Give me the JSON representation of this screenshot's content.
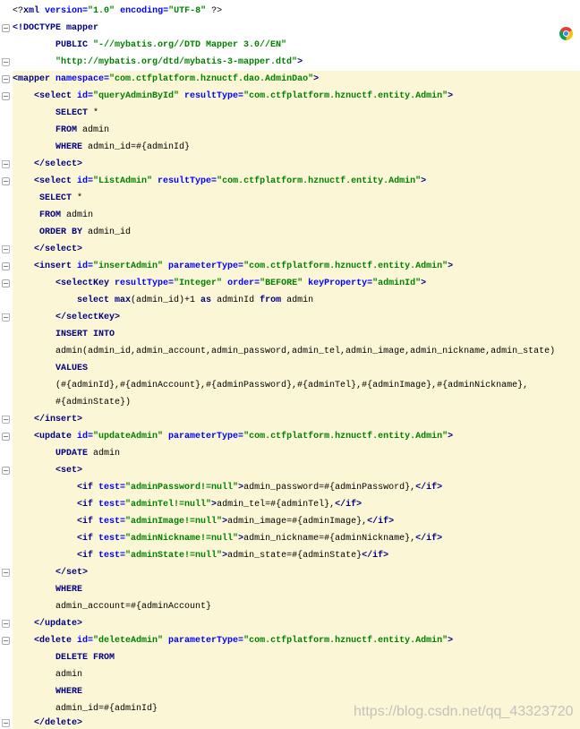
{
  "colors": {
    "tag": "#000080",
    "attr": "#0000ff",
    "val": "#008000",
    "kw": "#000080",
    "txt": "#000000",
    "highlight": "#fbf6d5",
    "gutter": "#ffffff"
  },
  "browser_popup": {
    "icon": "chrome-icon"
  },
  "watermark": {
    "text": "https://blog.csdn.net/qq_43323720"
  },
  "editor": {
    "lines": [
      {
        "tokens": [
          {
            "txt": "<?"
          },
          {
            "tag": "xml"
          },
          {
            "attr": " version="
          },
          {
            "val": "\"1.0\""
          },
          {
            "attr": " encoding="
          },
          {
            "val": "\"UTF-8\""
          },
          {
            "txt": " ?>"
          }
        ]
      },
      {
        "fold_icon": "fold-collapse-icon",
        "tokens": [
          {
            "tag": "<!DOCTYPE mapper"
          }
        ]
      },
      {
        "tokens": [
          {
            "tag": "        PUBLIC "
          },
          {
            "val": "\"-//mybatis.org//DTD Mapper 3.0//EN\""
          }
        ]
      },
      {
        "fold_icon": "fold-end-icon",
        "tokens": [
          {
            "val": "        \"http://mybatis.org/dtd/mybatis-3-mapper.dtd\""
          },
          {
            "tag": ">"
          }
        ]
      },
      {
        "highlighted": true,
        "fold_icon": "fold-collapse-icon",
        "tokens": [
          {
            "tag": "<mapper"
          },
          {
            "attr": " namespace="
          },
          {
            "val": "\"com.ctfplatform.hznuctf.dao.AdminDao\""
          },
          {
            "tag": ">"
          }
        ]
      },
      {
        "highlighted": true,
        "fold_icon": "fold-collapse-icon",
        "tokens": [
          {
            "tag": "    <select"
          },
          {
            "attr": " id="
          },
          {
            "val": "\"queryAdminById\""
          },
          {
            "attr": " resultType="
          },
          {
            "val": "\"com.ctfplatform.hznuctf.entity.Admin\""
          },
          {
            "tag": ">"
          }
        ]
      },
      {
        "highlighted": true,
        "tokens": [
          {
            "kw": "        SELECT"
          },
          {
            "txt": " *"
          }
        ]
      },
      {
        "highlighted": true,
        "tokens": [
          {
            "kw": "        FROM"
          },
          {
            "txt": " admin"
          }
        ]
      },
      {
        "highlighted": true,
        "tokens": [
          {
            "kw": "        WHERE"
          },
          {
            "txt": " admin_id=#{adminId}"
          }
        ]
      },
      {
        "highlighted": true,
        "fold_icon": "fold-end-icon",
        "tokens": [
          {
            "tag": "    </select>"
          }
        ]
      },
      {
        "highlighted": true,
        "fold_icon": "fold-collapse-icon",
        "tokens": [
          {
            "tag": "    <select"
          },
          {
            "attr": " id="
          },
          {
            "val": "\"ListAdmin\""
          },
          {
            "attr": " resultType="
          },
          {
            "val": "\"com.ctfplatform.hznuctf.entity.Admin\""
          },
          {
            "tag": ">"
          }
        ]
      },
      {
        "highlighted": true,
        "tokens": [
          {
            "kw": "     SELECT"
          },
          {
            "txt": " *"
          }
        ]
      },
      {
        "highlighted": true,
        "tokens": [
          {
            "kw": "     FROM"
          },
          {
            "txt": " admin"
          }
        ]
      },
      {
        "highlighted": true,
        "tokens": [
          {
            "kw": "     ORDER BY"
          },
          {
            "txt": " admin_id"
          }
        ]
      },
      {
        "highlighted": true,
        "fold_icon": "fold-end-icon",
        "tokens": [
          {
            "tag": "    </select>"
          }
        ]
      },
      {
        "highlighted": true,
        "fold_icon": "fold-collapse-icon",
        "tokens": [
          {
            "tag": "    <insert"
          },
          {
            "attr": " id="
          },
          {
            "val": "\"insertAdmin\""
          },
          {
            "attr": " parameterType="
          },
          {
            "val": "\"com.ctfplatform.hznuctf.entity.Admin\""
          },
          {
            "tag": ">"
          }
        ]
      },
      {
        "highlighted": true,
        "fold_icon": "fold-collapse-icon",
        "tokens": [
          {
            "tag": "        <selectKey"
          },
          {
            "attr": " resultType="
          },
          {
            "val": "\"Integer\""
          },
          {
            "attr": " order="
          },
          {
            "val": "\"BEFORE\""
          },
          {
            "attr": " keyProperty="
          },
          {
            "val": "\"adminId\""
          },
          {
            "tag": ">"
          }
        ]
      },
      {
        "highlighted": true,
        "tokens": [
          {
            "kw": "            select max"
          },
          {
            "txt": "(admin_id)+1 "
          },
          {
            "kw": "as"
          },
          {
            "txt": " adminId "
          },
          {
            "kw": "from"
          },
          {
            "txt": " admin"
          }
        ]
      },
      {
        "highlighted": true,
        "fold_icon": "fold-end-icon",
        "tokens": [
          {
            "tag": "        </selectKey>"
          }
        ]
      },
      {
        "highlighted": true,
        "tokens": [
          {
            "kw": "        INSERT INTO"
          }
        ]
      },
      {
        "highlighted": true,
        "tokens": [
          {
            "txt": "        admin(admin_id,admin_account,admin_password,admin_tel,admin_image,admin_nickname,admin_state)"
          }
        ]
      },
      {
        "highlighted": true,
        "tokens": [
          {
            "kw": "        VALUES"
          }
        ]
      },
      {
        "highlighted": true,
        "tokens": [
          {
            "txt": "        (#{adminId},#{adminAccount},#{adminPassword},#{adminTel},#{adminImage},#{adminNickname},"
          }
        ]
      },
      {
        "highlighted": true,
        "tokens": [
          {
            "txt": "        #{adminState})"
          }
        ]
      },
      {
        "highlighted": true,
        "fold_icon": "fold-end-icon",
        "tokens": [
          {
            "tag": "    </insert>"
          }
        ]
      },
      {
        "highlighted": true,
        "fold_icon": "fold-collapse-icon",
        "tokens": [
          {
            "tag": "    <update"
          },
          {
            "attr": " id="
          },
          {
            "val": "\"updateAdmin\""
          },
          {
            "attr": " parameterType="
          },
          {
            "val": "\"com.ctfplatform.hznuctf.entity.Admin\""
          },
          {
            "tag": ">"
          }
        ]
      },
      {
        "highlighted": true,
        "tokens": [
          {
            "kw": "        UPDATE"
          },
          {
            "txt": " admin"
          }
        ]
      },
      {
        "highlighted": true,
        "fold_icon": "fold-collapse-icon",
        "tokens": [
          {
            "tag": "        <set>"
          }
        ]
      },
      {
        "highlighted": true,
        "tokens": [
          {
            "tag": "            <if"
          },
          {
            "attr": " test="
          },
          {
            "val": "\"adminPassword!=null\""
          },
          {
            "tag": ">"
          },
          {
            "txt": "admin_password=#{adminPassword},"
          },
          {
            "tag": "</if>"
          }
        ]
      },
      {
        "highlighted": true,
        "tokens": [
          {
            "tag": "            <if"
          },
          {
            "attr": " test="
          },
          {
            "val": "\"adminTel!=null\""
          },
          {
            "tag": ">"
          },
          {
            "txt": "admin_tel=#{adminTel},"
          },
          {
            "tag": "</if>"
          }
        ]
      },
      {
        "highlighted": true,
        "tokens": [
          {
            "tag": "            <if"
          },
          {
            "attr": " test="
          },
          {
            "val": "\"adminImage!=null\""
          },
          {
            "tag": ">"
          },
          {
            "txt": "admin_image=#{adminImage},"
          },
          {
            "tag": "</if>"
          }
        ]
      },
      {
        "highlighted": true,
        "tokens": [
          {
            "tag": "            <if"
          },
          {
            "attr": " test="
          },
          {
            "val": "\"adminNickname!=null\""
          },
          {
            "tag": ">"
          },
          {
            "txt": "admin_nickname=#{adminNickname},"
          },
          {
            "tag": "</if>"
          }
        ]
      },
      {
        "highlighted": true,
        "tokens": [
          {
            "tag": "            <if"
          },
          {
            "attr": " test="
          },
          {
            "val": "\"adminState!=null\""
          },
          {
            "tag": ">"
          },
          {
            "txt": "admin_state=#{adminState}"
          },
          {
            "tag": "</if>"
          }
        ]
      },
      {
        "highlighted": true,
        "fold_icon": "fold-end-icon",
        "tokens": [
          {
            "tag": "        </set>"
          }
        ]
      },
      {
        "highlighted": true,
        "tokens": [
          {
            "kw": "        WHERE"
          }
        ]
      },
      {
        "highlighted": true,
        "tokens": [
          {
            "txt": "        admin_account=#{adminAccount}"
          }
        ]
      },
      {
        "highlighted": true,
        "fold_icon": "fold-end-icon",
        "tokens": [
          {
            "tag": "    </update>"
          }
        ]
      },
      {
        "highlighted": true,
        "fold_icon": "fold-collapse-icon",
        "tokens": [
          {
            "tag": "    <delete"
          },
          {
            "attr": " id="
          },
          {
            "val": "\"deleteAdmin\""
          },
          {
            "attr": " parameterType="
          },
          {
            "val": "\"com.ctfplatform.hznuctf.entity.Admin\""
          },
          {
            "tag": ">"
          }
        ]
      },
      {
        "highlighted": true,
        "tokens": [
          {
            "kw": "        DELETE FROM"
          }
        ]
      },
      {
        "highlighted": true,
        "tokens": [
          {
            "txt": "        admin"
          }
        ]
      },
      {
        "highlighted": true,
        "tokens": [
          {
            "kw": "        WHERE"
          }
        ]
      },
      {
        "highlighted": true,
        "tokens": [
          {
            "txt": "        admin_id=#{adminId}"
          }
        ]
      },
      {
        "highlighted": true,
        "fold_icon": "fold-end-icon",
        "tokens": [
          {
            "tag": "    </delete>"
          }
        ]
      }
    ]
  }
}
